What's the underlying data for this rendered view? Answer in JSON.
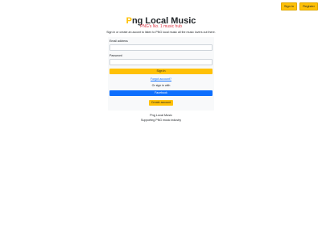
{
  "header": {
    "signin_label": "Sign in",
    "register_label": "Register"
  },
  "brand": {
    "first_letter": "P",
    "rest": "ng Local Music",
    "accent_color": "#ffc107"
  },
  "tagline": "PNG's No. 1 music hub",
  "intro": "Sign in or create an accont to listen to PNG local music all the music lovers out there.",
  "form": {
    "email_label": "Email address",
    "email_value": "",
    "password_label": "Password",
    "password_value": "",
    "signin_button": "Sign in",
    "forgot_link": "Forgot account?",
    "or_text": "Or sign in with",
    "facebook_button": "Facebook",
    "create_button": "Create account"
  },
  "footer": {
    "title": "Png Local Music",
    "subtitle": "Supporting PNG music industry"
  },
  "colors": {
    "yellow": "#ffc107",
    "blue": "#0d6efd",
    "red": "#dc3545",
    "card_bg": "#f8f9fa"
  }
}
